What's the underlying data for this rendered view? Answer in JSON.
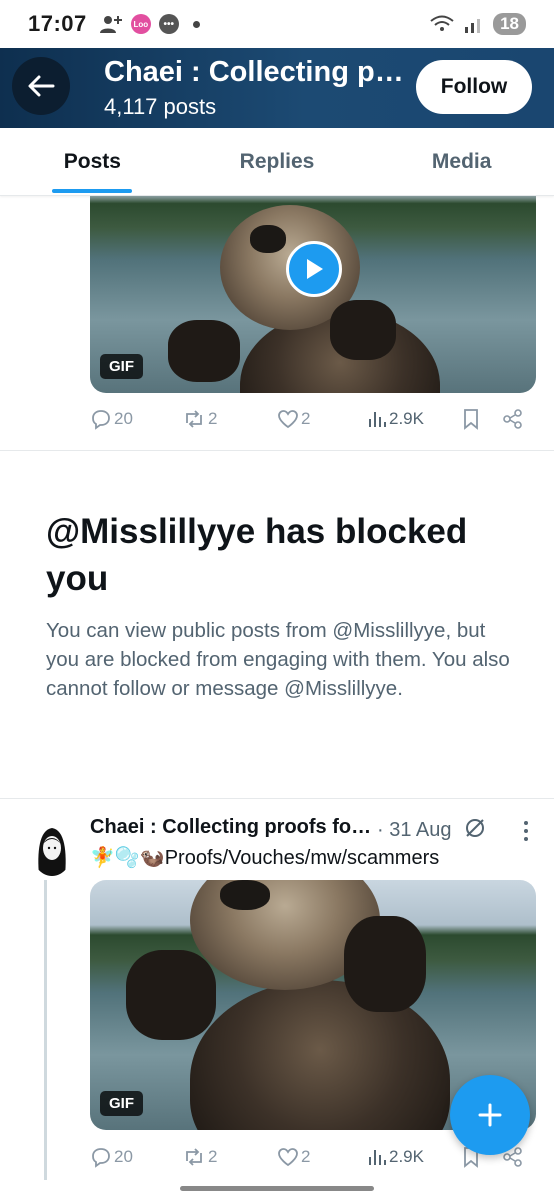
{
  "status_bar": {
    "time": "17:07",
    "battery": "18",
    "app_badge": "Loo"
  },
  "header": {
    "title": "Chaei : Collecting proofs",
    "posts_count": "4,117 posts",
    "follow_label": "Follow"
  },
  "tabs": [
    {
      "label": "Posts",
      "active": true
    },
    {
      "label": "Replies",
      "active": false
    },
    {
      "label": "Media",
      "active": false
    }
  ],
  "top_post": {
    "media_badge": "GIF",
    "stats": {
      "replies": "20",
      "reposts": "2",
      "likes": "2",
      "views": "2.9K"
    }
  },
  "blocked_notice": {
    "title": "@Misslillyye has blocked you",
    "body": "You can view public posts from @Misslillyye, but you are blocked from engaging with them. You also cannot follow or message @Misslillyye."
  },
  "post": {
    "author": "Chaei : Collecting proofs for scammers",
    "date": "· 31 Aug",
    "text": "🧚🫧🦦Proofs/Vouches/mw/scammers",
    "media_badge": "GIF",
    "stats": {
      "replies": "20",
      "reposts": "2",
      "likes": "2",
      "views": "2.9K"
    }
  },
  "colors": {
    "accent": "#1d9bf0",
    "header_bg": "#1c4a73",
    "muted": "#536471"
  }
}
